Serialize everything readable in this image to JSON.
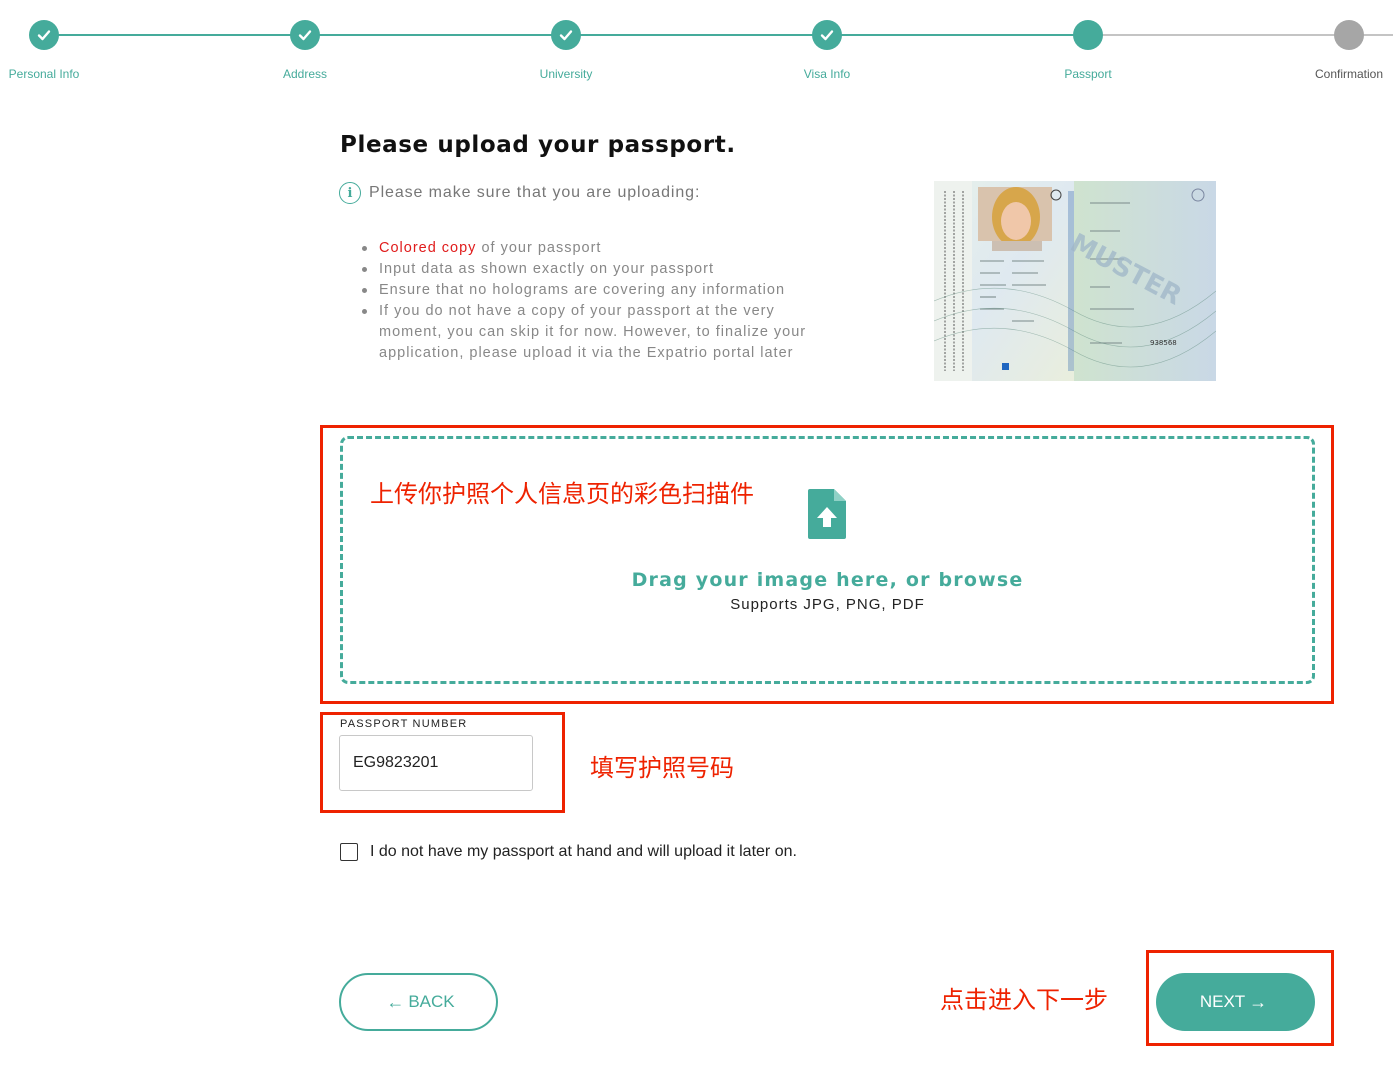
{
  "colors": {
    "accent": "#45ab9b",
    "pending": "#a6a6a6",
    "annotation": "#ee2200",
    "highlight_red": "#e01c1c"
  },
  "stepper": {
    "steps": [
      {
        "label": "Personal Info",
        "status": "completed",
        "icon": "check-icon"
      },
      {
        "label": "Address",
        "status": "completed",
        "icon": "check-icon"
      },
      {
        "label": "University",
        "status": "completed",
        "icon": "check-icon"
      },
      {
        "label": "Visa Info",
        "status": "completed",
        "icon": "check-icon"
      },
      {
        "label": "Passport",
        "status": "current",
        "icon": ""
      },
      {
        "label": "Confirmation",
        "status": "pending",
        "icon": ""
      }
    ]
  },
  "main": {
    "title": "Please upload your passport.",
    "info_icon": "info-icon",
    "info_text": "Please make sure that you are uploading:",
    "bullets": {
      "b1_highlight": "Colored copy",
      "b1_rest": " of your passport",
      "b2": "Input data as shown exactly on your passport",
      "b3": "Ensure that no holograms are covering any information",
      "b4": "If you do not have a copy of your passport at the very moment, you can skip it for now. However, to finalize your application, please upload it via the Expatrio portal later"
    },
    "sample_image": {
      "stamp_text": "MUSTER",
      "number_text": "938568"
    }
  },
  "dropzone": {
    "icon": "file-upload-icon",
    "drag_text": "Drag your image here, or browse",
    "supports_text": "Supports JPG, PNG, PDF"
  },
  "passport_number": {
    "label": "PASSPORT NUMBER",
    "value": "EG9823201"
  },
  "checkbox": {
    "label": "I do not have my passport at hand and will upload it later on.",
    "checked": false
  },
  "buttons": {
    "back_label": "BACK",
    "back_icon": "arrow-left-icon",
    "next_label": "NEXT",
    "next_icon": "arrow-right-icon"
  },
  "annotations": {
    "upload_note": "上传你护照个人信息页的彩色扫描件",
    "number_note": "填写护照号码",
    "next_note": "点击进入下一步"
  }
}
